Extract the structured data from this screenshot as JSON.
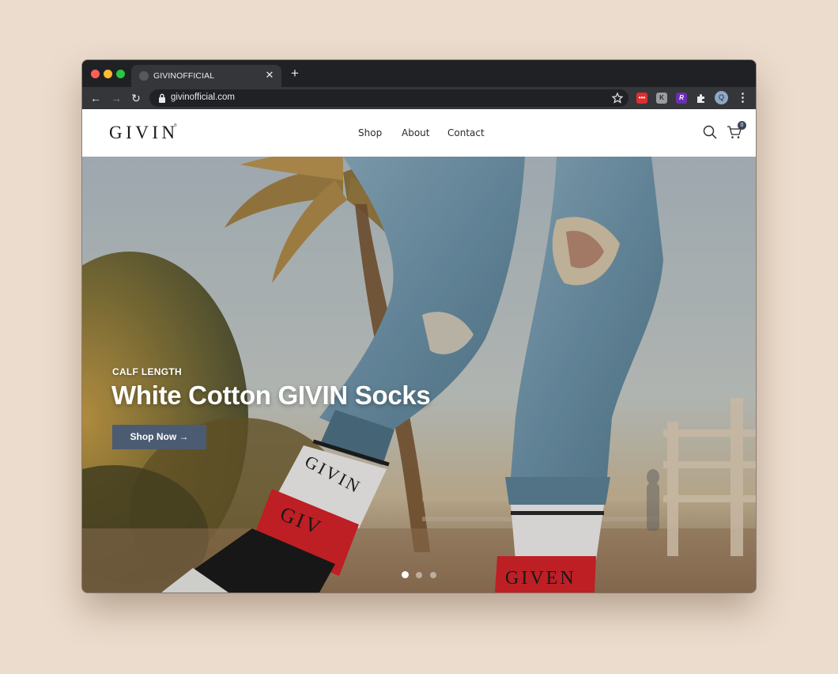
{
  "browser": {
    "tab_title": "GIVINOFFICIAL",
    "url": "givinofficial.com",
    "avatar_letter": "Q",
    "extensions": [
      "red-dots-extension-icon",
      "k-extension-icon",
      "r-extension-icon",
      "puzzle-extensions-icon"
    ]
  },
  "site": {
    "logo": "GIVIN",
    "logo_mark": "®",
    "nav": {
      "shop": "Shop",
      "about": "About",
      "contact": "Contact"
    },
    "cart_count": "0"
  },
  "hero": {
    "eyebrow": "CALF LENGTH",
    "title": "White Cotton GIVIN Socks",
    "button_label": "Shop Now →",
    "slides_total": 3,
    "active_slide": 1
  },
  "colors": {
    "background": "#ecdccd",
    "chrome": "#202124",
    "toolbar": "#35363a",
    "button": "#4b5b72",
    "sock_red": "#d8242a"
  }
}
